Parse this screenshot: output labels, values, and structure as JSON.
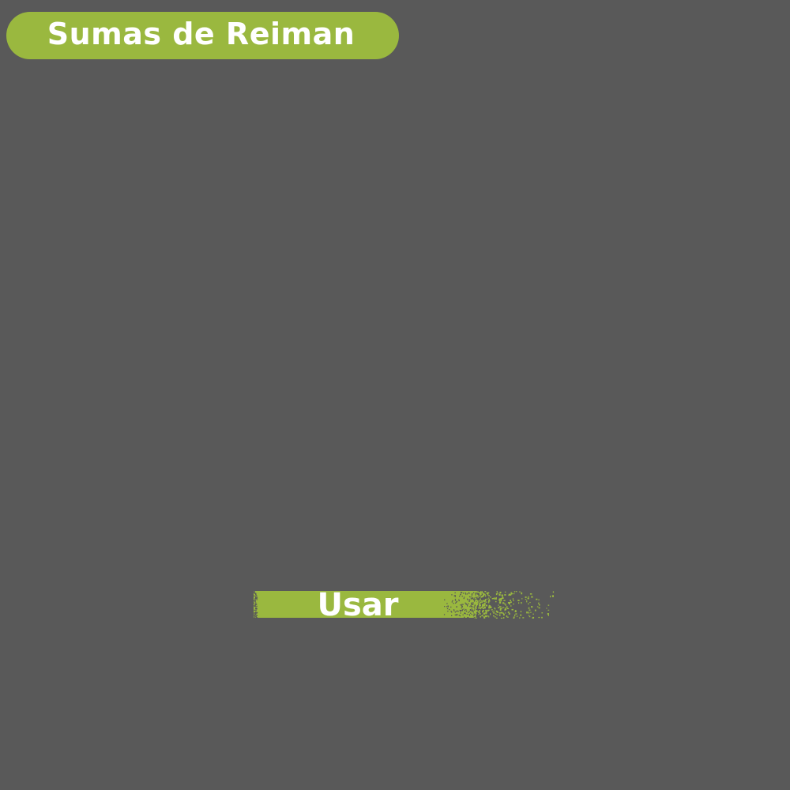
{
  "app": {
    "title": "Sumas de Reiman"
  },
  "actions": {
    "use_label": "Usar"
  },
  "colors": {
    "background": "#595959",
    "accent": "#9ab83f",
    "text": "#ffffff"
  }
}
